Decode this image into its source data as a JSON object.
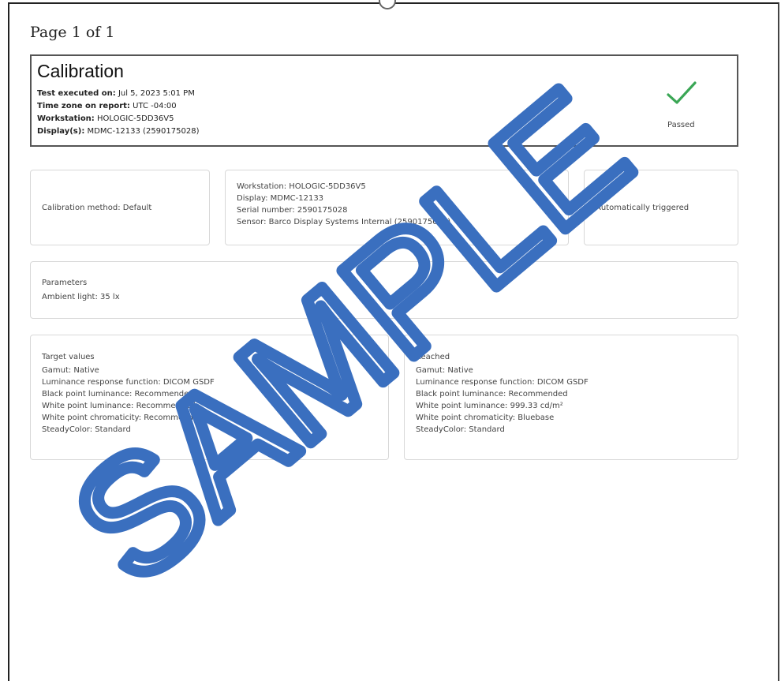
{
  "page": {
    "label": "Page 1 of 1"
  },
  "header": {
    "title": "Calibration",
    "fields": [
      {
        "label": "Test executed on:",
        "value": "Jul 5, 2023 5:01 PM"
      },
      {
        "label": "Time zone on report:",
        "value": "UTC -04:00"
      },
      {
        "label": "Workstation:",
        "value": "HOLOGIC-5DD36V5"
      },
      {
        "label": "Display(s):",
        "value": "MDMC-12133 (2590175028)"
      }
    ],
    "status": "Passed",
    "status_color": "#3aa655"
  },
  "method_card": {
    "text": "Calibration method: Default"
  },
  "info_card": {
    "lines": [
      "Workstation: HOLOGIC-5DD36V5",
      "Display: MDMC-12133",
      "Serial number: 2590175028",
      "Sensor: Barco Display Systems Internal (2590175028)"
    ]
  },
  "trigger_card": {
    "text": "Automatically triggered"
  },
  "parameters_card": {
    "title": "Parameters",
    "lines": [
      "Ambient light: 35 lx"
    ]
  },
  "target_card": {
    "title": "Target values",
    "lines": [
      "Gamut: Native",
      "Luminance response function: DICOM GSDF",
      "Black point luminance: Recommended",
      "White point luminance: Recommended",
      "White point chromaticity: Recommended",
      "SteadyColor: Standard"
    ]
  },
  "reached_card": {
    "title": "Reached",
    "lines": [
      "Gamut: Native",
      "Luminance response function: DICOM GSDF",
      "Black point luminance: Recommended",
      "White point luminance: 999.33 cd/m²",
      "White point chromaticity: Bluebase",
      "SteadyColor: Standard"
    ]
  },
  "watermark": {
    "text": "SAMPLE",
    "color": "#3a6fbf"
  }
}
